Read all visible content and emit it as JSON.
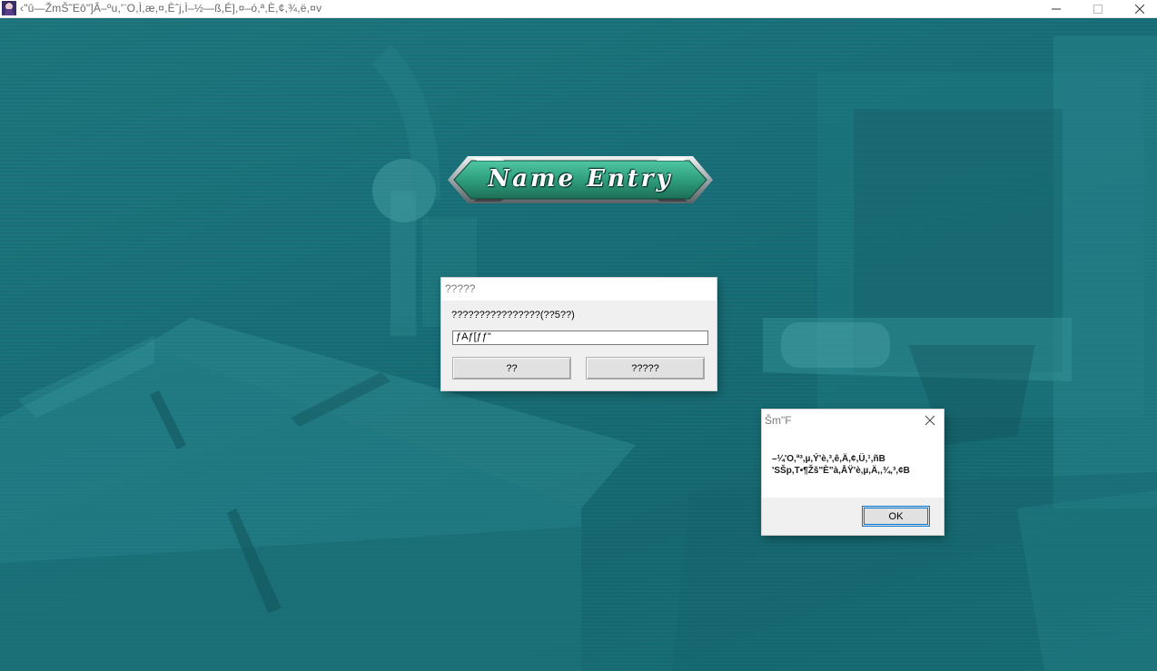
{
  "window": {
    "title": "‹\"û—ŽmŠ˜Eô\"]Â–ºu,'¨O,Ì,æ,¤,Èˆj,Ì–½—ß,É],¤–ó,ª,È,¢,¾,ë,¤v",
    "controls": [
      "minimize",
      "maximize",
      "close"
    ]
  },
  "banner": {
    "text": "Name Entry",
    "color": "#2f9e7c"
  },
  "name_dialog": {
    "title": "?????",
    "prompt": "????????????????(??5??)",
    "input_value": "ƒAƒ[ƒƒ\"",
    "ok_label": "??",
    "cancel_label": "?????"
  },
  "message_box": {
    "title": "Šm\"F",
    "message_line1": "–¼'O,ª³,µ,­Ý'è,³,ê,Ä,¢,Ü,¹,ñB",
    "message_line2": "'SŠp,T•¶Žš\"È\"à,ÅŸ'è,µ,Ä,­,¾,³,¢B",
    "ok_label": "OK"
  },
  "colors": {
    "background_teal": "#19707a",
    "dialog_gray": "#f0f0f0",
    "focus_blue": "#0078d7"
  }
}
